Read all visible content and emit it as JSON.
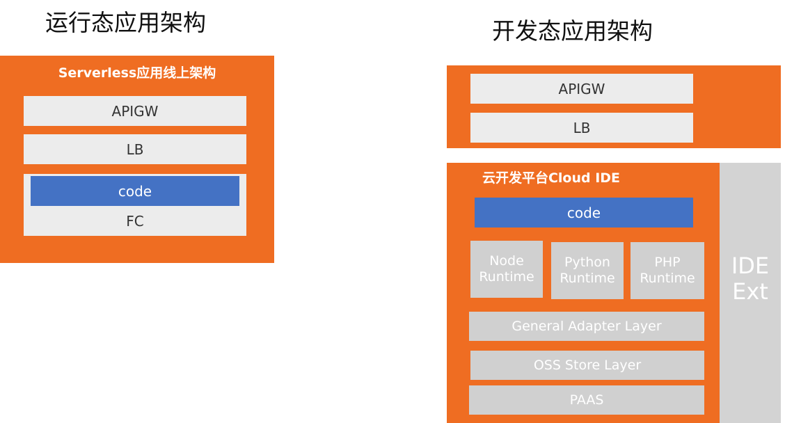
{
  "left": {
    "heading": "运行态应用架构",
    "panel_label": "Serverless应用线上架构",
    "apigw": "APIGW",
    "lb": "LB",
    "code": "code",
    "fc": "FC"
  },
  "right": {
    "heading": "开发态应用架构",
    "top_panel": {
      "apigw": "APIGW",
      "lb": "LB"
    },
    "ide_panel": {
      "label": "云开发平台Cloud IDE",
      "code": "code",
      "runtimes": [
        {
          "line1": "Node",
          "line2": "Runtime"
        },
        {
          "line1": "Python",
          "line2": "Runtime"
        },
        {
          "line1": "PHP",
          "line2": "Runtime"
        }
      ],
      "general_adapter": "General Adapter Layer",
      "oss_store": "OSS Store Layer",
      "paas": "PAAS"
    },
    "ide_ext": {
      "line1": "IDE",
      "line2": "Ext"
    }
  },
  "colors": {
    "panel_orange": "#ef6d22",
    "code_blue": "#4472c4",
    "box_light": "#ececec",
    "box_gray": "#d0d0d0"
  }
}
